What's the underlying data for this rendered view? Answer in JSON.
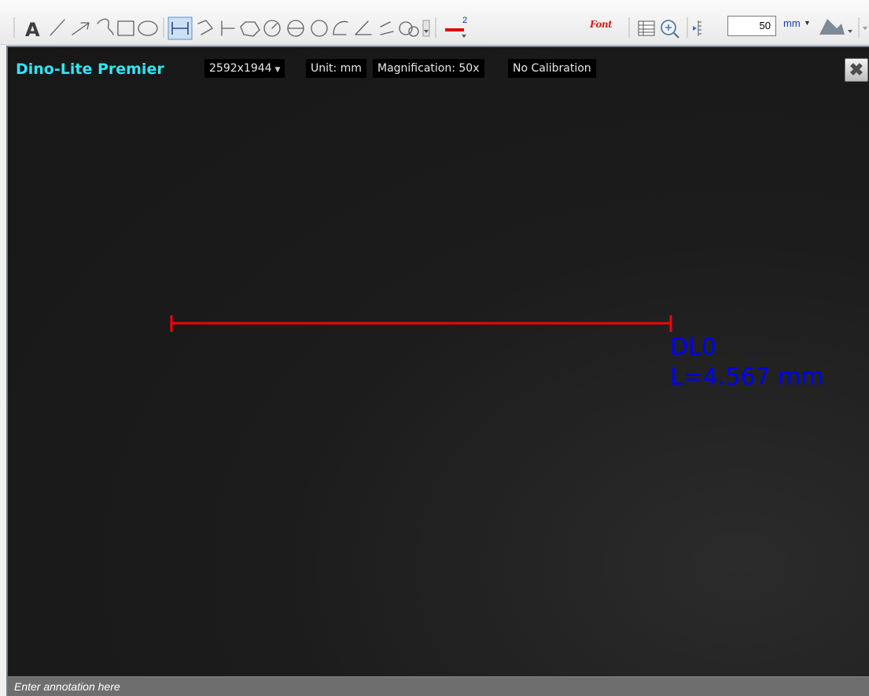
{
  "toolbar": {
    "tools": [
      {
        "icon": "text-tool-icon"
      },
      {
        "icon": "line-tool-icon"
      },
      {
        "icon": "arrow-tool-icon"
      },
      {
        "icon": "freehand-tool-icon"
      },
      {
        "icon": "rectangle-tool-icon"
      },
      {
        "icon": "ellipse-tool-icon"
      },
      {
        "icon": "distance-measure-icon",
        "active": true
      },
      {
        "icon": "polyline-measure-icon"
      },
      {
        "icon": "parallel-line-measure-icon"
      },
      {
        "icon": "polygon-measure-icon"
      },
      {
        "icon": "circle-center-measure-icon"
      },
      {
        "icon": "circle-diameter-measure-icon"
      },
      {
        "icon": "circle-3point-measure-icon"
      },
      {
        "icon": "arc-measure-icon"
      },
      {
        "icon": "angle-measure-icon"
      },
      {
        "icon": "four-point-angle-icon"
      },
      {
        "icon": "center-distance-icon"
      }
    ],
    "line_width": "2",
    "font_button_label": "Font",
    "zoom_value": "50",
    "unit_label": "mm",
    "accent_color": "#e00000"
  },
  "viewer": {
    "device_name": "Dino-Lite Premier",
    "resolution": "2592x1944",
    "unit": "Unit: mm",
    "magnification": "Magnification: 50x",
    "calibration": "No Calibration",
    "background_color": "#1a1a1a",
    "measurement": {
      "name": "DL0",
      "length_text": "L=4.567 mm",
      "line_color": "#ff0000",
      "label_color": "#0000ff"
    }
  },
  "annotation": {
    "placeholder": "Enter annotation here"
  }
}
